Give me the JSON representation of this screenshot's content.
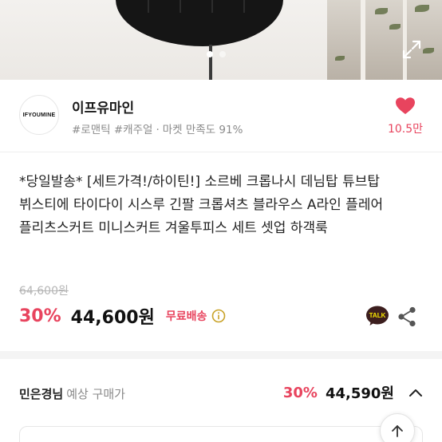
{
  "hero": {
    "image_count_indicator": 2,
    "active_index": 0
  },
  "shop": {
    "logo_text": "IFYOUMINE",
    "name": "이프유마인",
    "tags": "#로맨틱 #캐주얼",
    "separator": "·",
    "rating": "마켓 만족도 91%",
    "likes": "10.5만"
  },
  "product": {
    "title": "*당일발송* [세트가격!/하이틴!] 소르베 크롭나시 데님탑 튜브탑 뷔스티에 타이다이 시스루 긴팔 크롭셔츠 블라우스 A라인 플레어 플리츠스커트 미니스커트 겨울투피스 세트 셋업 하객룩",
    "original_price": "64,600원",
    "discount": "30%",
    "price": "44,600원",
    "shipping": "무료배송"
  },
  "talk": {
    "label": "TALK"
  },
  "expected": {
    "user": "민은경님",
    "label": "예상 구매가",
    "discount": "30%",
    "price": "44,590원"
  },
  "colors": {
    "accent": "#e8445e",
    "kakao": "#3c1e1e"
  }
}
